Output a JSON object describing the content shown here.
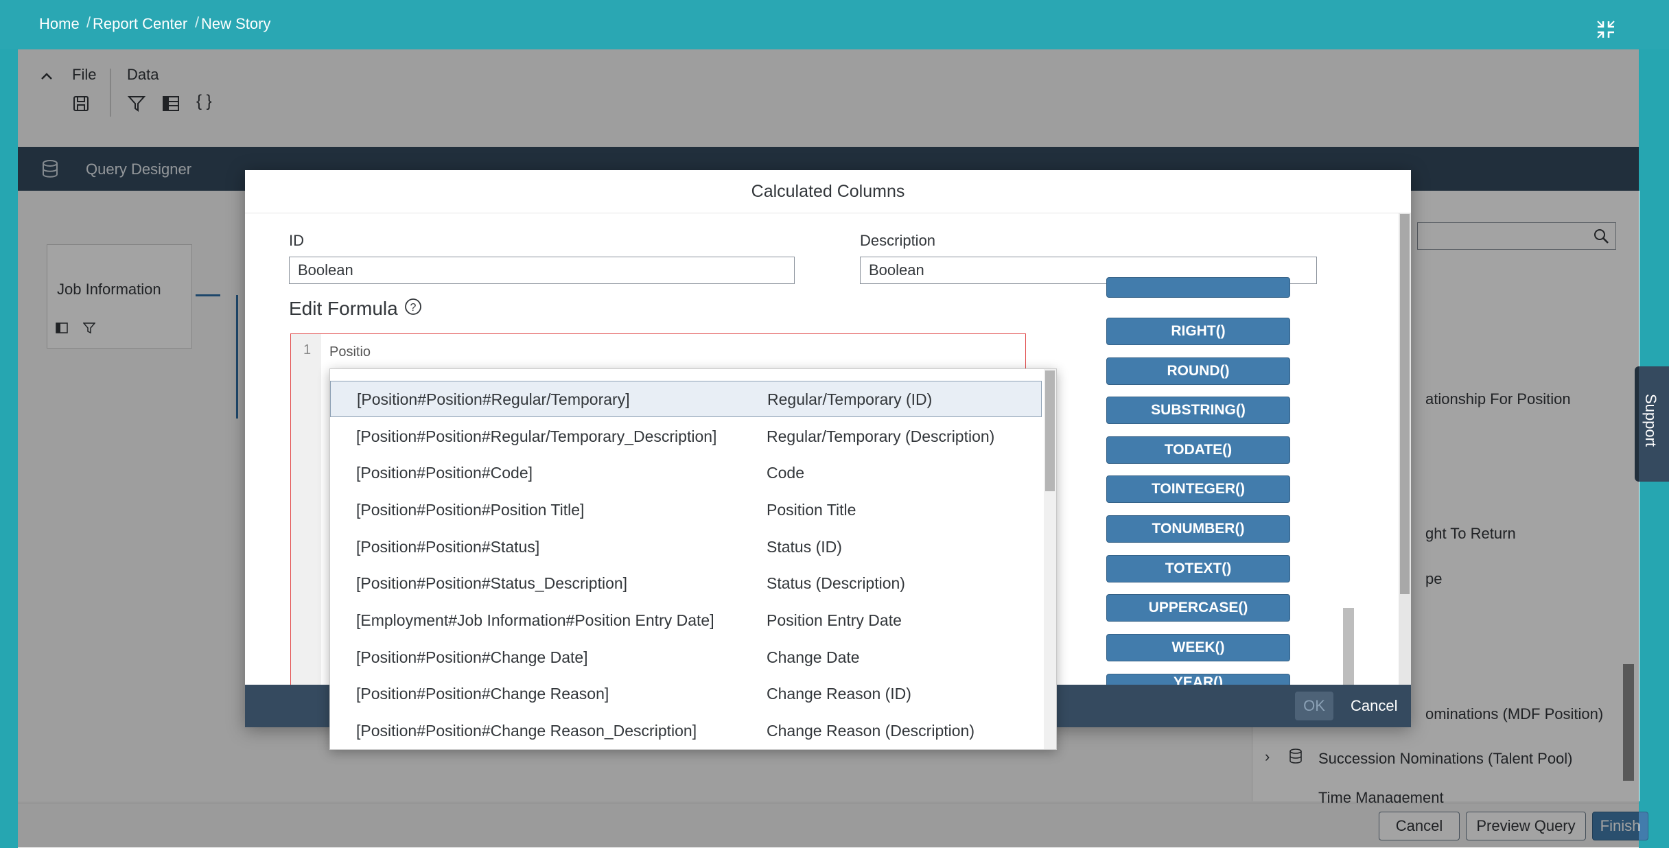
{
  "shell": {
    "breadcrumbs": [
      "Home",
      "Report Center",
      "New Story"
    ]
  },
  "toolbar": {
    "file_label": "File",
    "data_label": "Data",
    "icons": [
      "save-icon",
      "filter-icon",
      "table-icon",
      "braces-icon"
    ]
  },
  "query_designer": {
    "title": "Query Designer"
  },
  "canvas": {
    "node_title": "Job Information"
  },
  "right_panel": {
    "partial_items": [
      "ationship For Position",
      "ght To Return",
      "pe",
      "ominations (MDF Position)"
    ],
    "tree_items": [
      "Succession Nominations (Talent Pool)",
      "Time Management"
    ]
  },
  "support_tab": "Support",
  "footer": {
    "cancel": "Cancel",
    "preview": "Preview Query",
    "finish": "Finish"
  },
  "dialog": {
    "title": "Calculated Columns",
    "id_label": "ID",
    "id_value": "Boolean",
    "description_label": "Description",
    "description_value": "Boolean",
    "edit_formula_label": "Edit Formula",
    "line_number": "1",
    "formula_text": "Positio",
    "functions": [
      "RIGHT()",
      "ROUND()",
      "SUBSTRING()",
      "TODATE()",
      "TOINTEGER()",
      "TONUMBER()",
      "TOTEXT()",
      "UPPERCASE()",
      "WEEK()",
      "YEAR()"
    ],
    "ok_label": "OK",
    "cancel_label": "Cancel"
  },
  "autocomplete": {
    "items": [
      {
        "key": "[Position#Position#Regular/Temporary]",
        "desc": "Regular/Temporary (ID)",
        "selected": true
      },
      {
        "key": "[Position#Position#Regular/Temporary_Description]",
        "desc": "Regular/Temporary (Description)"
      },
      {
        "key": "[Position#Position#Code]",
        "desc": "Code"
      },
      {
        "key": "[Position#Position#Position Title]",
        "desc": "Position Title"
      },
      {
        "key": "[Position#Position#Status]",
        "desc": "Status (ID)"
      },
      {
        "key": "[Position#Position#Status_Description]",
        "desc": "Status (Description)"
      },
      {
        "key": "[Employment#Job Information#Position Entry Date]",
        "desc": "Position Entry Date"
      },
      {
        "key": "[Position#Position#Change Date]",
        "desc": "Change Date"
      },
      {
        "key": "[Position#Position#Change Reason]",
        "desc": "Change Reason (ID)"
      },
      {
        "key": "[Position#Position#Change Reason_Description]",
        "desc": "Change Reason (Description)"
      }
    ]
  },
  "colors": {
    "shell": "#2aa7b3",
    "header_dark": "#354a5f",
    "function_button": "#427cac",
    "formula_border": "#e04a4a"
  }
}
